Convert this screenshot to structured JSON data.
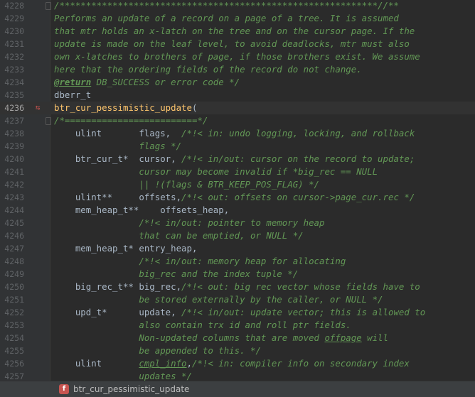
{
  "editor": {
    "current_line": "4236",
    "lines": [
      {
        "n": "4228",
        "segs": [
          [
            "c",
            "/************************************************************//**"
          ]
        ]
      },
      {
        "n": "4229",
        "segs": [
          [
            "c",
            "Performs an update of a record on a page of a tree. It is assumed"
          ]
        ]
      },
      {
        "n": "4230",
        "segs": [
          [
            "c",
            "that mtr holds an x-latch on the tree and on the cursor page. If the"
          ]
        ]
      },
      {
        "n": "4231",
        "segs": [
          [
            "c",
            "update is made on the leaf level, to avoid deadlocks, mtr must also"
          ]
        ]
      },
      {
        "n": "4232",
        "segs": [
          [
            "c",
            "own x-latches to brothers of page, if those brothers exist. We assume"
          ]
        ]
      },
      {
        "n": "4233",
        "segs": [
          [
            "c",
            "here that the ordering fields of the record do not change."
          ]
        ]
      },
      {
        "n": "4234",
        "segs": [
          [
            "tag",
            "@return"
          ],
          [
            "c",
            " DB_SUCCESS or error code */"
          ]
        ]
      },
      {
        "n": "4235",
        "segs": [
          [
            "t",
            "dberr_t"
          ]
        ]
      },
      {
        "n": "4236",
        "segs": [
          [
            "fn",
            "btr_cur_pessimistic_update"
          ],
          [
            "p",
            "("
          ]
        ]
      },
      {
        "n": "4237",
        "segs": [
          [
            "c",
            "/*=========================*/"
          ]
        ]
      },
      {
        "n": "4238",
        "segs": [
          [
            "t",
            "    ulint       flags,  "
          ],
          [
            "c",
            "/*!< in: undo logging, locking, and rollback"
          ]
        ]
      },
      {
        "n": "4239",
        "segs": [
          [
            "c",
            "                flags */"
          ]
        ]
      },
      {
        "n": "4240",
        "segs": [
          [
            "t",
            "    btr_cur_t*  cursor, "
          ],
          [
            "c",
            "/*!< in/out: cursor on the record to update;"
          ]
        ]
      },
      {
        "n": "4241",
        "segs": [
          [
            "c",
            "                cursor may become invalid if *big_rec == NULL"
          ]
        ]
      },
      {
        "n": "4242",
        "segs": [
          [
            "c",
            "                || !(flags & BTR_KEEP_POS_FLAG) */"
          ]
        ]
      },
      {
        "n": "4243",
        "segs": [
          [
            "t",
            "    ulint**     offsets,"
          ],
          [
            "c",
            "/*!< out: offsets on cursor->page_cur.rec */"
          ]
        ]
      },
      {
        "n": "4244",
        "segs": [
          [
            "t",
            "    mem_heap_t**    offsets_heap,"
          ]
        ]
      },
      {
        "n": "4245",
        "segs": [
          [
            "c",
            "                /*!< in/out: pointer to memory heap"
          ]
        ]
      },
      {
        "n": "4246",
        "segs": [
          [
            "c",
            "                that can be emptied, or NULL */"
          ]
        ]
      },
      {
        "n": "4247",
        "segs": [
          [
            "t",
            "    mem_heap_t* entry_heap,"
          ]
        ]
      },
      {
        "n": "4248",
        "segs": [
          [
            "c",
            "                /*!< in/out: memory heap for allocating"
          ]
        ]
      },
      {
        "n": "4249",
        "segs": [
          [
            "c",
            "                big_rec and the index tuple */"
          ]
        ]
      },
      {
        "n": "4250",
        "segs": [
          [
            "t",
            "    big_rec_t** big_rec,"
          ],
          [
            "c",
            "/*!< out: big rec vector whose fields have to"
          ]
        ]
      },
      {
        "n": "4251",
        "segs": [
          [
            "c",
            "                be stored externally by the caller, or NULL */"
          ]
        ]
      },
      {
        "n": "4252",
        "segs": [
          [
            "t",
            "    upd_t*      update, "
          ],
          [
            "c",
            "/*!< in/out: update vector; this is allowed to"
          ]
        ]
      },
      {
        "n": "4253",
        "segs": [
          [
            "c",
            "                also contain trx id and roll ptr fields."
          ]
        ]
      },
      {
        "n": "4254",
        "segs": [
          [
            "c",
            "                Non-updated columns that are moved "
          ],
          [
            "u",
            "offpage"
          ],
          [
            "c",
            " will"
          ]
        ]
      },
      {
        "n": "4255",
        "segs": [
          [
            "c",
            "                be appended to this. */"
          ]
        ]
      },
      {
        "n": "4256",
        "segs": [
          [
            "t",
            "    ulint       "
          ],
          [
            "u",
            "cmpl_info"
          ],
          [
            "t",
            ","
          ],
          [
            "c",
            "/*!< in: compiler info on secondary index"
          ]
        ]
      },
      {
        "n": "4257",
        "segs": [
          [
            "c",
            "                updates */"
          ]
        ]
      }
    ]
  },
  "status_bar": {
    "function_badge": "f",
    "function_name": "btr_cur_pessimistic_update",
    "badge_color": "#c75450"
  }
}
